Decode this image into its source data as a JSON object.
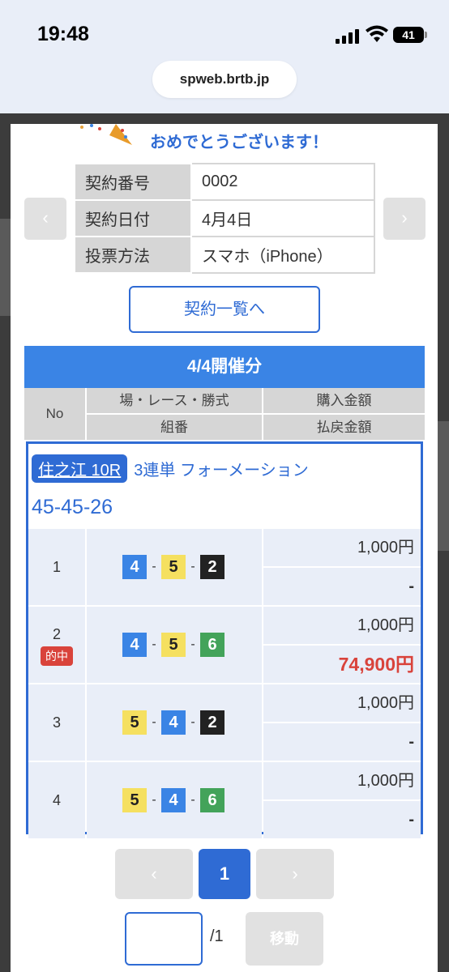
{
  "status": {
    "time": "19:48",
    "battery": "41"
  },
  "browser": {
    "url": "spweb.brtb.jp"
  },
  "congrats": {
    "text": "おめでとうございます！"
  },
  "contract": {
    "rows": [
      {
        "label": "契約番号",
        "value": "0002"
      },
      {
        "label": "契約日付",
        "value": "4月4日"
      },
      {
        "label": "投票方法",
        "value": "スマホ（iPhone）"
      }
    ],
    "prev_glyph": "‹",
    "next_glyph": "›",
    "list_button": "契約一覧へ"
  },
  "session": {
    "title": "4/4開催分"
  },
  "table_header": {
    "no": "No",
    "place_race": "場・レース・勝式",
    "purchase": "購入金額",
    "combo": "組番",
    "refund": "払戻金額"
  },
  "bet": {
    "race": "住之江 10R",
    "type": "3連単 フォーメーション",
    "combo_label": "45-45-26",
    "rows": [
      {
        "no": "1",
        "hit": false,
        "boats": [
          "4",
          "5",
          "2"
        ],
        "purchase": "1,000円",
        "refund": "-"
      },
      {
        "no": "2",
        "hit": true,
        "hit_label": "的中",
        "boats": [
          "4",
          "5",
          "6"
        ],
        "purchase": "1,000円",
        "refund": "74,900円"
      },
      {
        "no": "3",
        "hit": false,
        "boats": [
          "5",
          "4",
          "2"
        ],
        "purchase": "1,000円",
        "refund": "-"
      },
      {
        "no": "4",
        "hit": false,
        "boats": [
          "5",
          "4",
          "6"
        ],
        "purchase": "1,000円",
        "refund": "-"
      }
    ],
    "dash": "-"
  },
  "pagination": {
    "prev_glyph": "‹",
    "current": "1",
    "next_glyph": "›",
    "total": "/1",
    "go_label": "移動",
    "input_value": ""
  },
  "colors": {
    "accent": "#2f6bd4",
    "header_bar": "#3a84e5",
    "win": "#d9433b",
    "boat4": "#3a84e5",
    "boat5": "#f5e060",
    "boat2": "#222222",
    "boat6": "#43a35a"
  }
}
